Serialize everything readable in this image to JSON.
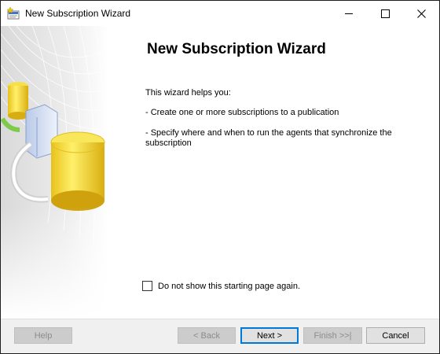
{
  "window": {
    "title": "New Subscription Wizard"
  },
  "icons": {
    "app": "wizard-app-icon",
    "minimize": "minimize-icon",
    "maximize": "maximize-icon",
    "close": "close-icon"
  },
  "main": {
    "heading": "New Subscription Wizard",
    "intro": "This wizard helps you:",
    "bullets": [
      "- Create one or more subscriptions to a publication",
      "- Specify where and when to run the agents that synchronize the subscription"
    ],
    "checkbox": {
      "label": "Do not show this starting page again.",
      "checked": false
    }
  },
  "buttons": {
    "help": "Help",
    "back": "< Back",
    "next": "Next >",
    "finish": "Finish >>|",
    "cancel": "Cancel"
  },
  "colors": {
    "accent": "#0078d7",
    "database_yellow": "#f0d53a",
    "disabled_button": "#cccccc"
  }
}
